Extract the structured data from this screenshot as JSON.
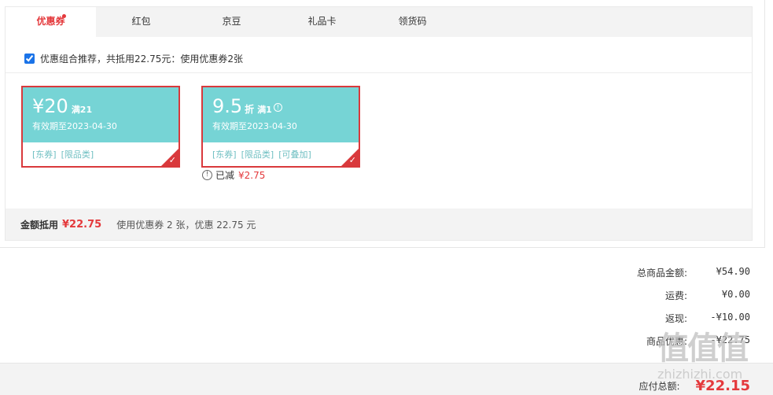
{
  "tabs": [
    {
      "label": "优惠券",
      "active": true,
      "has_dot": true
    },
    {
      "label": "红包",
      "active": false
    },
    {
      "label": "京豆",
      "active": false
    },
    {
      "label": "礼品卡",
      "active": false
    },
    {
      "label": "领货码",
      "active": false
    }
  ],
  "combo": {
    "checked": true,
    "text": "优惠组合推荐，共抵用22.75元：使用优惠券2张"
  },
  "coupons": [
    {
      "amount": "¥20",
      "unit": "",
      "condition": "满21",
      "validity": "有效期至2023-04-30",
      "tags": [
        "[东券]",
        "[限品类]"
      ],
      "selected": true
    },
    {
      "amount": "9.5",
      "unit": "折",
      "condition": "满1",
      "validity": "有效期至2023-04-30",
      "tags": [
        "[东券]",
        "[限品类]",
        "[可叠加]"
      ],
      "selected": true
    }
  ],
  "reduced": {
    "label": "已减",
    "value": "¥2.75"
  },
  "footer": {
    "label": "金额抵用",
    "amount": "¥22.75",
    "desc": "使用优惠券 2 张，优惠 22.75 元"
  },
  "summary": [
    {
      "label": "总商品金额:",
      "value": "¥54.90"
    },
    {
      "label": "运费:",
      "value": "¥0.00"
    },
    {
      "label": "返现:",
      "value": "-¥10.00"
    },
    {
      "label": "商品优惠:",
      "value": "-¥22.75"
    }
  ],
  "total": {
    "label": "应付总额:",
    "value": "¥22.15"
  },
  "watermark": {
    "big": "值值值",
    "small": "zhizhizhi.com"
  },
  "colors": {
    "accent": "#e4393c",
    "coupon_bg": "#76d4d5"
  }
}
